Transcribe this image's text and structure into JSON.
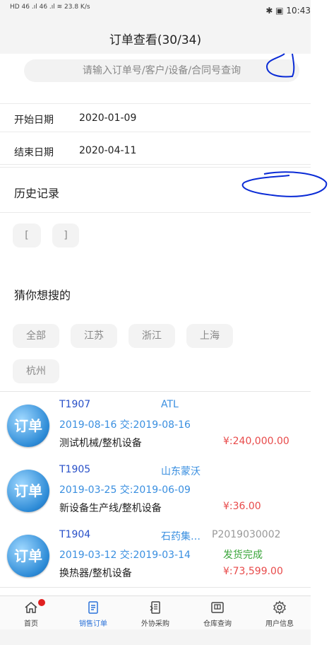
{
  "status_bar": {
    "left": "HD 46 .ıl 46 .ıl ≋ 23.8 K/s",
    "right": "✱ ▣ 10:43"
  },
  "header": {
    "title": "订单查看(30/34)"
  },
  "search": {
    "placeholder": "请输入订单号/客户/设备/合同号查询"
  },
  "filters": {
    "start_label": "开始日期",
    "start_value": "2020-01-09",
    "end_label": "结束日期",
    "end_value": "2020-04-11"
  },
  "history": {
    "title": "历史记录",
    "chips": [
      "[",
      "]"
    ]
  },
  "suggest": {
    "title": "猜你想搜的",
    "chips": [
      "全部",
      "江苏",
      "浙江",
      "上海",
      "杭州"
    ]
  },
  "orders": [
    {
      "icon_text": "订单",
      "id": "T1907",
      "customer": "ATL",
      "contract": "",
      "dates": "2019-08-16 交:2019-08-16",
      "status": "",
      "product": "测试机械/整机设备",
      "amount": "¥:240,000.00"
    },
    {
      "icon_text": "订单",
      "id": "T1905",
      "customer": "山东蒙沃",
      "contract": "",
      "dates": "2019-03-25 交:2019-06-09",
      "status": "",
      "product": "新设备生产线/整机设备",
      "amount": "¥:36.00"
    },
    {
      "icon_text": "订单",
      "id": "T1904",
      "customer": "石药集…",
      "contract": "P2019030002",
      "dates": "2019-03-12 交:2019-03-14",
      "status": "发货完成",
      "product": "换热器/整机设备",
      "amount": "¥:73,599.00"
    }
  ],
  "tabs": [
    {
      "label": "首页",
      "icon": "home-icon"
    },
    {
      "label": "销售订单",
      "icon": "sales-order-icon"
    },
    {
      "label": "外协采购",
      "icon": "purchase-icon"
    },
    {
      "label": "仓库查询",
      "icon": "warehouse-icon"
    },
    {
      "label": "用户信息",
      "icon": "gear-icon"
    }
  ],
  "colors": {
    "accent": "#2b72d9",
    "amount": "#e84a4a",
    "status_done": "#3aa53a",
    "ink_annotation": "#0a2bd6"
  }
}
